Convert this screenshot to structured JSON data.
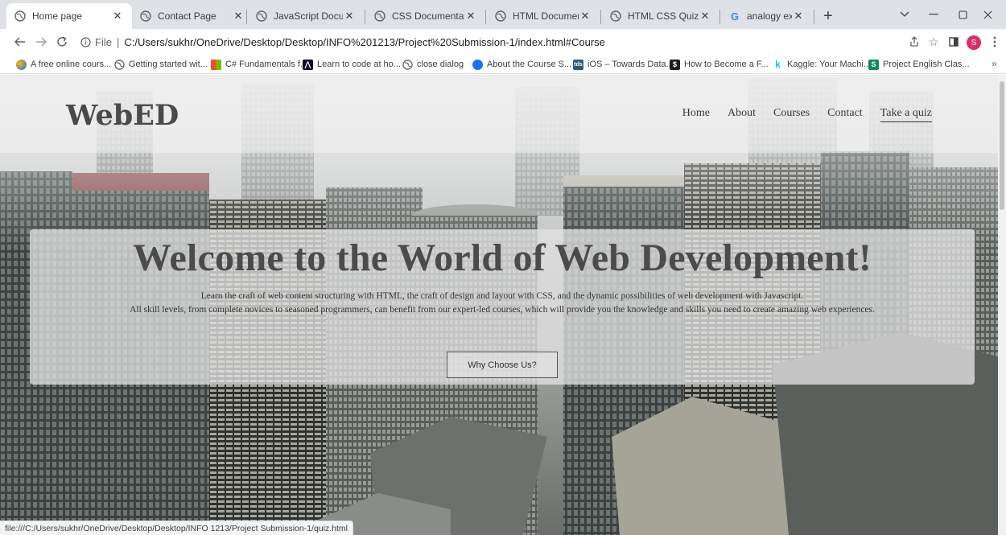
{
  "browser": {
    "tabs": [
      {
        "title": "Home page",
        "icon": "globe-icon",
        "active": true
      },
      {
        "title": "Contact Page",
        "icon": "globe-icon"
      },
      {
        "title": "JavaScript Documenta",
        "icon": "globe-icon"
      },
      {
        "title": "CSS Documentation",
        "icon": "globe-icon"
      },
      {
        "title": "HTML Documentation",
        "icon": "globe-icon"
      },
      {
        "title": "HTML CSS Quiz",
        "icon": "globe-icon"
      },
      {
        "title": "analogy examples - G",
        "icon": "google-icon"
      }
    ],
    "new_tab": "+",
    "address": {
      "scheme_label": "File",
      "url": "C:/Users/sukhr/OneDrive/Desktop/Desktop/INFO%201213/Project%20Submission-1/index.html#Course"
    },
    "profile_initial": "S",
    "bookmarks": [
      {
        "label": "A free online cours...",
        "icon": "colorful-dot-icon",
        "color": "#1a73e8"
      },
      {
        "label": "Getting started wit...",
        "icon": "globe-icon",
        "color": "#5f6368"
      },
      {
        "label": "C# Fundamentals f...",
        "icon": "microsoft-icon",
        "color": "#f25022"
      },
      {
        "label": "Learn to code at ho...",
        "icon": "freecodecamp-icon",
        "color": "#0a0a23"
      },
      {
        "label": "close dialog",
        "icon": "globe-icon",
        "color": "#5f6368"
      },
      {
        "label": "About the Course S...",
        "icon": "shield-icon",
        "color": "#1a73e8"
      },
      {
        "label": "iOS – Towards Data...",
        "icon": "tds-icon",
        "color": "#355876"
      },
      {
        "label": "How to Become a F...",
        "icon": "dollar-icon",
        "color": "#1e1e1e"
      },
      {
        "label": "Kaggle: Your Machi...",
        "icon": "kaggle-icon",
        "color": "#20beff"
      },
      {
        "label": "Project English Clas...",
        "icon": "teams-icon",
        "color": "#128a55"
      }
    ],
    "bookmarks_more": "»",
    "status_url": "file:///C:/Users/sukhr/OneDrive/Desktop/Desktop/INFO 1213/Project Submission-1/quiz.html"
  },
  "site": {
    "logo": "WebED",
    "nav": [
      {
        "label": "Home"
      },
      {
        "label": "About"
      },
      {
        "label": "Courses"
      },
      {
        "label": "Contact"
      },
      {
        "label": "Take a quiz",
        "active": true
      }
    ],
    "hero": {
      "heading": "Welcome to the World of Web Development!",
      "line1": "Learn the craft of web content structuring with HTML, the craft of design and layout with CSS, and the dynamic possibilities of web development with Javascript.",
      "line2": "All skill levels, from complete novices to seasoned programmers, can benefit from our expert-led courses, which will provide you the knowledge and skills you need to create amazing web experiences.",
      "cta": "Why Choose Us?"
    }
  }
}
